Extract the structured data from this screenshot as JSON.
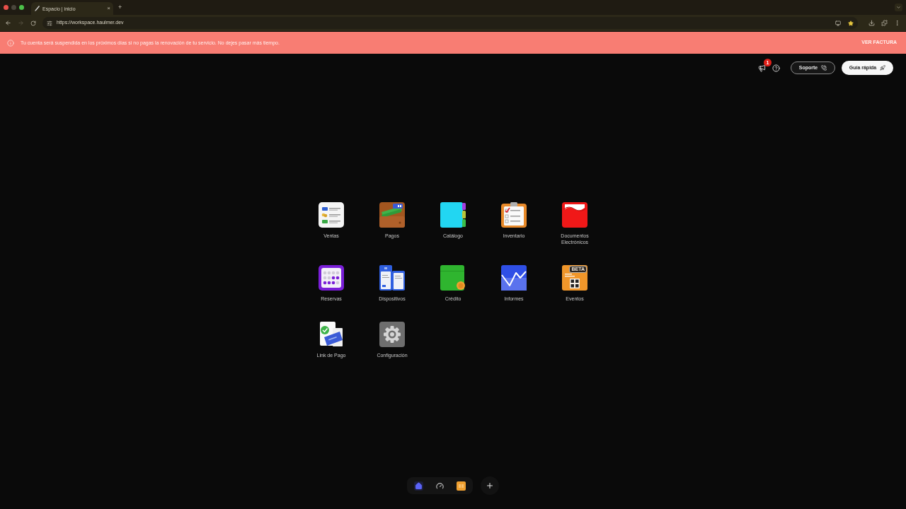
{
  "browser": {
    "tab": {
      "title": "Espacio | inicio",
      "close": "×"
    },
    "new_tab": "+",
    "url": "https://workspace.haulmer.dev"
  },
  "alert_banner": {
    "message": "Tu cuenta será suspendida en los próximos días si no pagas la renovación de tu servicio. No dejes pasar más tiempo.",
    "action": "VER FACTURA"
  },
  "header": {
    "notifications_badge": "1",
    "buttons": [
      {
        "label": "Soporte",
        "kind": "support"
      },
      {
        "label": "Guía rápida",
        "kind": "guide"
      }
    ]
  },
  "apps": [
    {
      "label": "Ventas",
      "kind": "ventas"
    },
    {
      "label": "Pagos",
      "kind": "pagos"
    },
    {
      "label": "Catálogo",
      "kind": "catalogo"
    },
    {
      "label": "Inventario",
      "kind": "inventario"
    },
    {
      "label": "Documentos Electrónicos",
      "kind": "documentos"
    },
    {
      "label": "Reservas",
      "kind": "reservas"
    },
    {
      "label": "Dispositivos",
      "kind": "dispositivos"
    },
    {
      "label": "Crédito",
      "kind": "credito"
    },
    {
      "label": "Informes",
      "kind": "informes"
    },
    {
      "label": "Eventos",
      "kind": "eventos",
      "badge": "BETA"
    },
    {
      "label": "Link de Pago",
      "kind": "link"
    },
    {
      "label": "Configuración",
      "kind": "configuracion"
    }
  ],
  "dock": {
    "items": [
      {
        "kind": "home",
        "selected": true
      },
      {
        "kind": "gauge",
        "selected": false
      },
      {
        "kind": "tile",
        "selected": false
      }
    ]
  }
}
